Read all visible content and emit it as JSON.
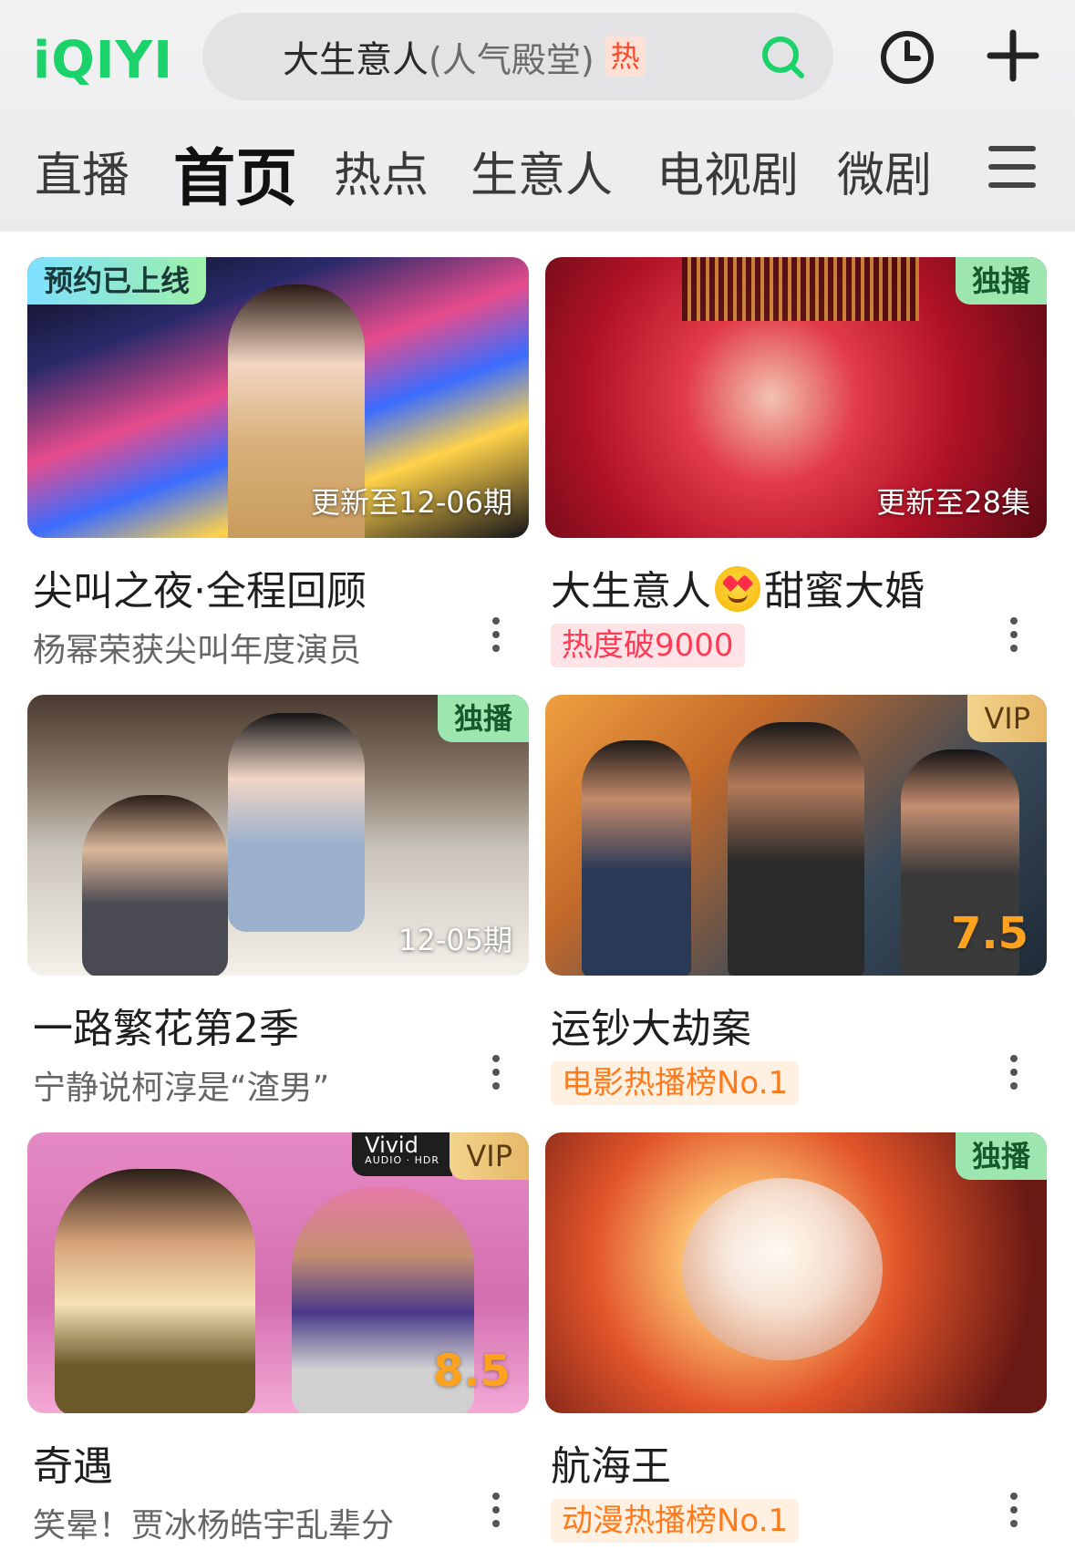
{
  "app": {
    "logo": "iQIYI",
    "search": {
      "query": "大生意人",
      "hint": "(人气殿堂)",
      "badge": "热"
    }
  },
  "nav": {
    "tabs": [
      "直播",
      "首页",
      "热点",
      "生意人",
      "电视剧",
      "微剧"
    ],
    "active_tab": "首页"
  },
  "cards": [
    {
      "badge": "预约已上线",
      "overlay": "更新至12-06期",
      "title": "尖叫之夜·全程回顾",
      "subtitle": "杨幂荣获尖叫年度演员",
      "thumb_colors": [
        "#e74c8c",
        "#3b6cff",
        "#ffd24a"
      ]
    },
    {
      "badge": "独播",
      "overlay": "更新至28集",
      "title_a": "大生意人",
      "emoji": "heart-eyes-emoji",
      "title_b": "甜蜜大婚",
      "tag": "热度破9000",
      "thumb_colors": [
        "#b01226",
        "#e23a48",
        "#5a0a14"
      ]
    },
    {
      "badge": "独播",
      "overlay": "12-05期",
      "title": "一路繁花第2季",
      "subtitle": "宁静说柯淳是“渣男”",
      "thumb_colors": [
        "#c9c3bb",
        "#8a7a6a",
        "#f4f1ea"
      ]
    },
    {
      "badge": "VIP",
      "score": "7.5",
      "title": "运钞大劫案",
      "tag": "电影热播榜No.1",
      "thumb_colors": [
        "#3a4a5a",
        "#c46a2a",
        "#f0a040"
      ]
    },
    {
      "badge": "VIP",
      "vivid": "Vivid",
      "vivid_sub": "AUDIO · HDR",
      "score": "8.5",
      "title": "奇遇",
      "subtitle": "笑晕！贾冰杨皓宇乱辈分",
      "thumb_colors": [
        "#e58ac4",
        "#d46fb0",
        "#f3a9d6"
      ]
    },
    {
      "badge": "独播",
      "title": "航海王",
      "tag": "动漫热播榜No.1",
      "thumb_colors": [
        "#6a1a14",
        "#e2552a",
        "#fbc070"
      ]
    }
  ],
  "colors": {
    "brand_green": "#1bd36a",
    "hot_red": "#ff3a55",
    "rank_orange": "#ff7a1a",
    "score_orange": "#ffa21f"
  }
}
